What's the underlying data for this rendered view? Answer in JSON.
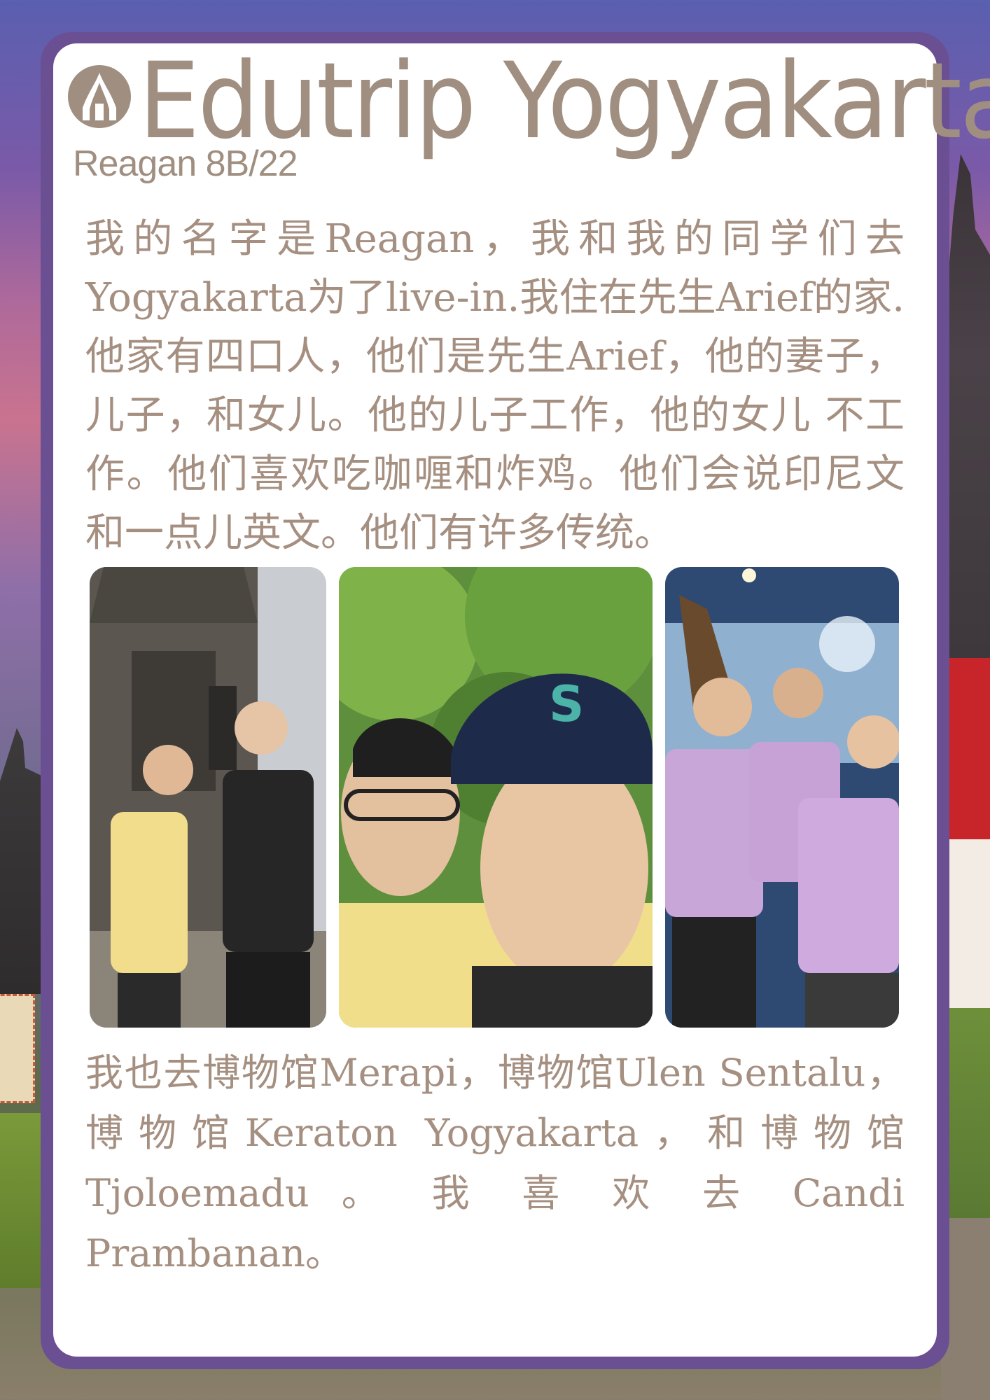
{
  "header": {
    "title": "Edutrip Yogyakarta",
    "subtitle": "Reagan 8B/22",
    "logo_icon": "temple-dome-icon"
  },
  "content": {
    "paragraph_1": "我的名字是Reagan，我和我的同学们去Yogyakarta为了live-in.我住在先生Arief的家.他家有四口人，他们是先生Arief，他的妻子，儿子，和女儿。他的儿子工作，他的女儿 不工作。他们喜欢吃咖喱和炸鸡。他们会说印尼文和一点儿英文。他们有许多传统。",
    "paragraph_2": "我也去博物馆Merapi，博物馆Ulen Sentalu，博物馆Keraton Yogyakarta，和博物馆Tjoloemadu 。 我 喜 欢 去 Candi Prambanan。"
  },
  "colors": {
    "title_text": "#a08f80",
    "body_text": "#a58f80",
    "frame": "#6b4f93",
    "card": "#ffffff"
  }
}
